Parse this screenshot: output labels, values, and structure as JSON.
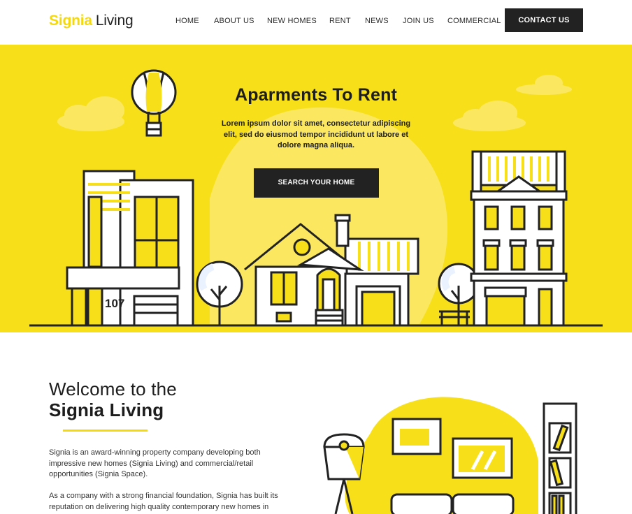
{
  "brand": {
    "bold": "Signia",
    "rest": "Living"
  },
  "nav": {
    "items": [
      "HOME",
      "ABOUT US",
      "NEW HOMES",
      "RENT",
      "NEWS",
      "JOIN US",
      "COMMERCIAL"
    ],
    "cta": "CONTACT US"
  },
  "hero": {
    "title": "Aparments To Rent",
    "text": "Lorem ipsum dolor sit amet, consectetur adipiscing elit, sed do eiusmod tempor incididunt ut labore et dolore magna aliqua.",
    "button": "SEARCH YOUR HOME",
    "house_number": "107"
  },
  "welcome": {
    "line1": "Welcome to the",
    "line2": "Signia Living",
    "para1": "Signia is an award-winning property company developing both impressive new homes (Signia Living) and commercial/retail opportunities (Signia Space).",
    "para2": "As a company with a strong financial foundation, Signia has built its reputation on delivering high quality contemporary new homes in"
  },
  "colors": {
    "accent": "#f7e019",
    "dark": "#222222",
    "white": "#ffffff"
  }
}
